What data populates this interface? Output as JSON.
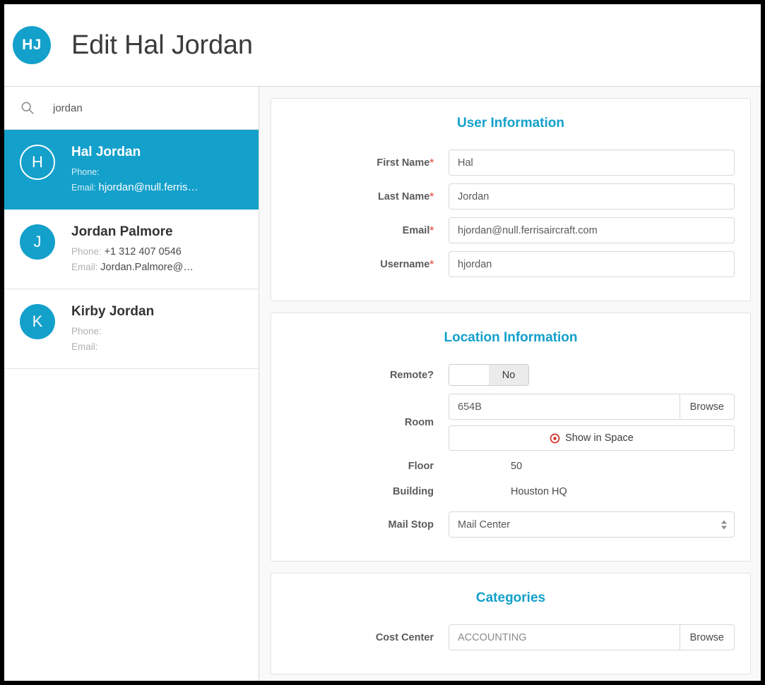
{
  "header": {
    "avatar_initials": "HJ",
    "title": "Edit Hal Jordan",
    "accent_color": "#13a0cb"
  },
  "sidebar": {
    "search": {
      "icon": "search-icon",
      "value": "jordan",
      "placeholder": "Search"
    },
    "people": [
      {
        "initial": "H",
        "name": "Hal Jordan",
        "phone_label": "Phone:",
        "phone": "",
        "email_label": "Email:",
        "email": "hjordan@null.ferris…",
        "selected": true
      },
      {
        "initial": "J",
        "name": "Jordan Palmore",
        "phone_label": "Phone:",
        "phone": "+1 312 407 0546",
        "email_label": "Email:",
        "email": "Jordan.Palmore@…",
        "selected": false
      },
      {
        "initial": "K",
        "name": "Kirby Jordan",
        "phone_label": "Phone:",
        "phone": "",
        "email_label": "Email:",
        "email": "",
        "selected": false
      }
    ]
  },
  "main": {
    "user_information": {
      "title": "User Information",
      "first_name_label": "First Name",
      "first_name_value": "Hal",
      "last_name_label": "Last Name",
      "last_name_value": "Jordan",
      "email_label": "Email",
      "email_value": "hjordan@null.ferrisaircraft.com",
      "username_label": "Username",
      "username_value": "hjordan",
      "required_marker": "*"
    },
    "location_information": {
      "title": "Location Information",
      "remote_label": "Remote?",
      "remote_value": "No",
      "room_label": "Room",
      "room_value": "654B",
      "room_browse_label": "Browse",
      "show_in_space_label": "Show in Space",
      "floor_label": "Floor",
      "floor_value": "50",
      "building_label": "Building",
      "building_value": "Houston HQ",
      "mail_stop_label": "Mail Stop",
      "mail_stop_value": "Mail Center"
    },
    "categories": {
      "title": "Categories",
      "cost_center_label": "Cost Center",
      "cost_center_value": "ACCOUNTING",
      "cost_center_browse_label": "Browse"
    }
  }
}
